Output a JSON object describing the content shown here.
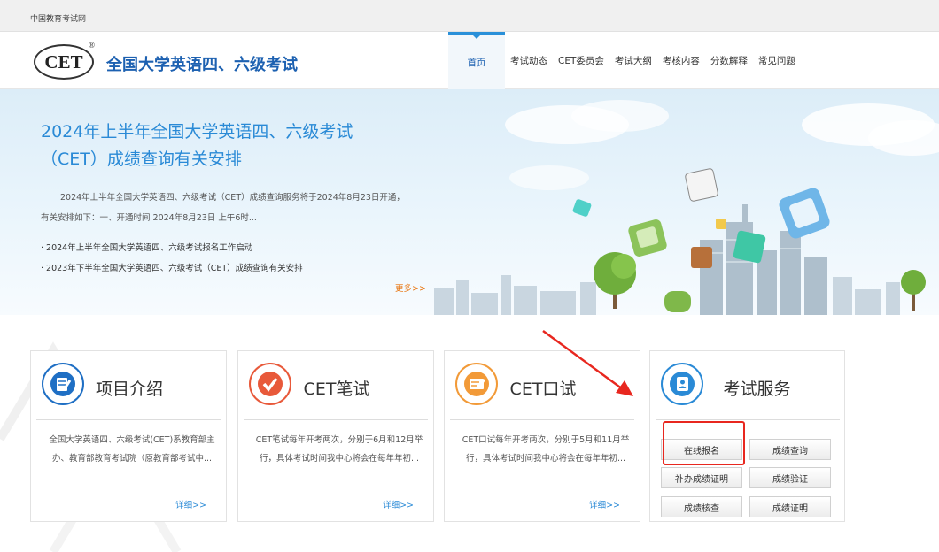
{
  "topbar": {
    "site_name": "中国教育考试网"
  },
  "header": {
    "logo_text": "CET",
    "logo_reg": "®",
    "title": "全国大学英语四、六级考试",
    "nav": [
      "首页",
      "考试动态",
      "CET委员会",
      "考试大纲",
      "考核内容",
      "分数解释",
      "常见问题"
    ]
  },
  "banner": {
    "headline": "2024年上半年全国大学英语四、六级考试（CET）成绩查询有关安排",
    "summary": "2024年上半年全国大学英语四、六级考试（CET）成绩查询服务将于2024年8月23日开通，有关安排如下：一、开通时间 2024年8月23日 上午6时...",
    "items": [
      "2024年上半年全国大学英语四、六级考试报名工作启动",
      "2023年下半年全国大学英语四、六级考试（CET）成绩查询有关安排"
    ],
    "more": "更多>>"
  },
  "cards": [
    {
      "title": "项目介绍",
      "desc": "全国大学英语四、六级考试(CET)系教育部主办、教育部教育考试院（原教育部考试中...",
      "detail": "详细>>",
      "icon": "document-edit-icon",
      "color": "#1f6fc4"
    },
    {
      "title": "CET笔试",
      "desc": "CET笔试每年开考两次，分别于6月和12月举行，具体考试时间我中心将会在每年年初...",
      "detail": "详细>>",
      "icon": "checkmark-icon",
      "color": "#e8593a"
    },
    {
      "title": "CET口试",
      "desc": "CET口试每年开考两次，分别于5月和11月举行，具体考试时间我中心将会在每年年初...",
      "detail": "详细>>",
      "icon": "screen-edit-icon",
      "color": "#f29a38"
    }
  ],
  "services": {
    "title": "考试服务",
    "icon": "contact-book-icon",
    "buttons": [
      "在线报名",
      "成绩查询",
      "补办成绩证明",
      "成绩验证",
      "成绩核查",
      "成绩证明"
    ]
  },
  "colors": {
    "brand_blue": "#1d61b1",
    "link_blue": "#2a8ad6",
    "more_orange": "#e8730c",
    "highlight_red": "#e8271f"
  }
}
